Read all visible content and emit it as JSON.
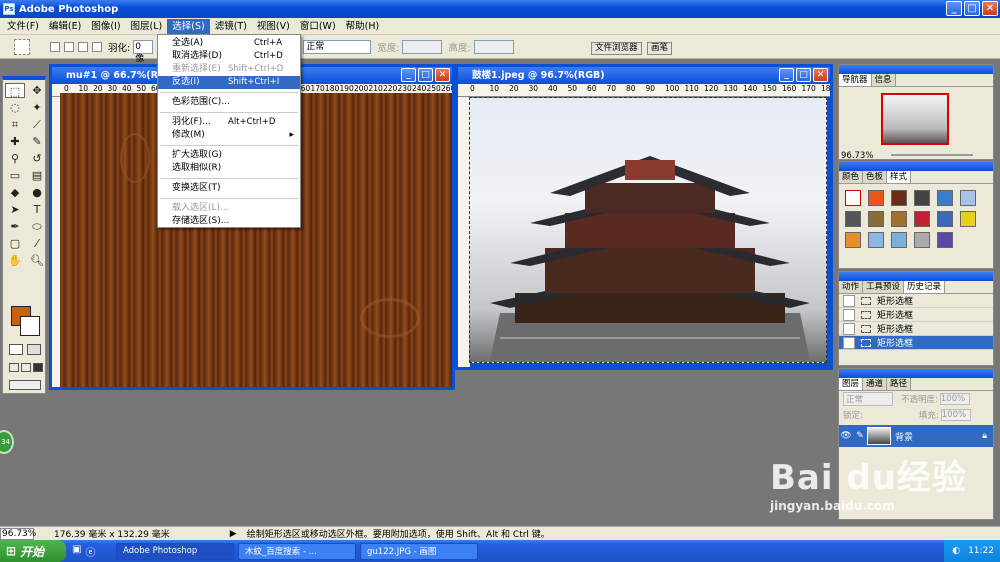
{
  "app": {
    "title": "Adobe Photoshop"
  },
  "menubar": [
    "文件(F)",
    "编辑(E)",
    "图像(I)",
    "图层(L)",
    "选择(S)",
    "滤镜(T)",
    "视图(V)",
    "窗口(W)",
    "帮助(H)"
  ],
  "options": {
    "feather_label": "羽化:",
    "feather_value": "0 像",
    "style_value": "正常",
    "width_label": "宽度:",
    "height_label": "高度:",
    "tab_browser": "文件浏览器",
    "tab_brush": "画笔"
  },
  "select_menu": [
    {
      "label": "全选(A)",
      "shortcut": "Ctrl+A"
    },
    {
      "label": "取消选择(D)",
      "shortcut": "Ctrl+D"
    },
    {
      "label": "重新选择(E)",
      "shortcut": "Shift+Ctrl+D",
      "disabled": true
    },
    {
      "label": "反选(I)",
      "shortcut": "Shift+Ctrl+I",
      "highlighted": true
    },
    {
      "sep": true
    },
    {
      "label": "色彩范围(C)..."
    },
    {
      "sep": true
    },
    {
      "label": "羽化(F)...",
      "shortcut": "Alt+Ctrl+D"
    },
    {
      "label": "修改(M)",
      "submenu": true
    },
    {
      "sep": true
    },
    {
      "label": "扩大选取(G)"
    },
    {
      "label": "选取相似(R)"
    },
    {
      "sep": true
    },
    {
      "label": "变换选区(T)"
    },
    {
      "sep": true
    },
    {
      "label": "载入选区(L)...",
      "disabled": true
    },
    {
      "label": "存储选区(S)..."
    }
  ],
  "doc1": {
    "title": "mu#1 @ 66.7%(RGB)",
    "ruler": [
      "0",
      "10",
      "20",
      "30",
      "40",
      "50",
      "60",
      "70",
      "80",
      "90",
      "100",
      "110",
      "120",
      "130",
      "140",
      "150",
      "160",
      "170",
      "180",
      "190",
      "200",
      "210",
      "220",
      "230",
      "240",
      "250",
      "260"
    ]
  },
  "doc2": {
    "title": "鼓楼1.jpeg @ 96.7%(RGB)",
    "ruler": [
      "0",
      "10",
      "20",
      "30",
      "40",
      "50",
      "60",
      "70",
      "80",
      "90",
      "100",
      "110",
      "120",
      "130",
      "140",
      "150",
      "160",
      "170",
      "180"
    ]
  },
  "navigator": {
    "tabs": [
      "导航器",
      "信息"
    ],
    "zoom": "96.73%"
  },
  "color_panel": {
    "tabs": [
      "颜色",
      "色板",
      "样式"
    ]
  },
  "history_panel": {
    "tabs": [
      "动作",
      "工具预设",
      "历史记录"
    ],
    "items": [
      "矩形选框",
      "矩形选框",
      "矩形选框",
      "矩形选框"
    ]
  },
  "layers_panel": {
    "tabs": [
      "图层",
      "通道",
      "路径"
    ],
    "blend": "正常",
    "opacity_label": "不透明度:",
    "opacity": "100%",
    "lock_label": "锁定:",
    "fill_label": "填充:",
    "fill": "100%",
    "layer_name": "背景"
  },
  "status": {
    "zoom": "96.73%",
    "size": "176.39 毫米 x 132.29 毫米",
    "hint": "绘制矩形选区或移动选区外框。要用附加选项，使用 Shift、Alt 和 Ctrl 键。"
  },
  "taskbar": {
    "start": "开始",
    "tasks": [
      "Adobe Photoshop",
      "木紋_百度搜索 - ...",
      "gu122.JPG - 画图"
    ],
    "time": "11:22"
  },
  "watermark": {
    "brand": "Bai du经验",
    "url": "jingyan.baidu.com"
  },
  "misc": {
    "green_badge": "34"
  },
  "colors": {
    "foreground": "#c8620c",
    "background": "#ffffff",
    "accent": "#0a4fd8"
  }
}
